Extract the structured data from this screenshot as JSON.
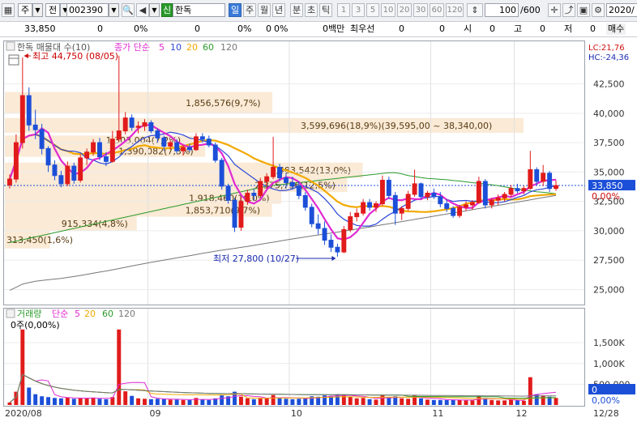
{
  "toolbar": {
    "market": "주",
    "market_type": "전",
    "code": "002390",
    "stock_tag": "신",
    "stock_name": "한독",
    "periods": [
      "일",
      "주",
      "월",
      "년",
      "분",
      "초",
      "틱"
    ],
    "selected_period": "일",
    "minutes": [
      "1",
      "3",
      "5",
      "10",
      "20",
      "30",
      "60",
      "120"
    ],
    "count": "100",
    "count_total": "/600",
    "date": "2020/",
    "right_label": "매수"
  },
  "inforow": {
    "price": "33,850",
    "change": "0",
    "pct1": "0",
    "pct1_unit": "0%",
    "v2": "0",
    "v2_unit": "0%",
    "v3": "0",
    "v3_unit": "0%",
    "v4_label": "0백만",
    "priority_label": "최우선",
    "v5": "0",
    "v6": "0",
    "open_label": "시",
    "open": "0",
    "high_label": "고",
    "high": "0",
    "low_label": "저",
    "low": "0"
  },
  "price_legend": {
    "title": "한독 매물대 수(10)",
    "ma_label": "종가 단순",
    "ma_periods": [
      "5",
      "10",
      "20",
      "60",
      "120"
    ],
    "ma_colors": [
      "#e02ad2",
      "#2b46d8",
      "#f2a900",
      "#2a9a2a",
      "#777777"
    ]
  },
  "volume_legend": {
    "title": "거래량",
    "ma_label": "단순",
    "ma_periods": [
      "5",
      "20",
      "60",
      "120"
    ],
    "ma_colors": [
      "#e02ad2",
      "#f2a900",
      "#2a9a2a",
      "#777777"
    ],
    "value_label": "0주(0,00%)"
  },
  "annotations": {
    "max_label": "최고 44,750 (08/05)",
    "min_label": "최저 27,800 (10/27)",
    "volume_profile_labels": [
      "1,856,576(9,7%)",
      "3,599,696(18,9%)(39,595,00 ~ 38,340,00)",
      "1,303,004(7,2%)",
      "1,390,082(7,3%)",
      "2,483,542(13,0%)",
      "2,375,756(12,5%)",
      "1,918,460(10,0%)",
      "1,853,710(9,7%)",
      "915,334(4,8%)",
      "313,450(1,6%)"
    ]
  },
  "right_axis": {
    "lc_label": "LC:21,76",
    "hc_label": "HC:-24,36",
    "price_ticks": [
      "42,500",
      "40,000",
      "37,500",
      "35,000",
      "32,500",
      "30,000",
      "27,500",
      "25,000"
    ],
    "current_price": "33,850",
    "current_pct": "0,00%",
    "volume_ticks": [
      "1,500K",
      "1,000K",
      "500,000"
    ],
    "current_volume": "0",
    "current_vol_pct": "0,00%"
  },
  "x_axis": {
    "labels": [
      "2020/08",
      "09",
      "10",
      "11",
      "12",
      "12/28"
    ]
  },
  "chart_data": {
    "type": "candlestick",
    "y_range": [
      24000,
      45500
    ],
    "volume_range": [
      0,
      2050000
    ],
    "candles": [
      [
        33900,
        34800,
        33600,
        34400,
        60000
      ],
      [
        34400,
        38200,
        34100,
        37500,
        320000
      ],
      [
        37500,
        44750,
        37000,
        41500,
        1820000
      ],
      [
        41500,
        42200,
        38500,
        39000,
        420000
      ],
      [
        39000,
        40300,
        37800,
        38600,
        260000
      ],
      [
        38600,
        39100,
        36500,
        37000,
        210000
      ],
      [
        37000,
        37200,
        35000,
        35600,
        190000
      ],
      [
        35600,
        36000,
        34300,
        34700,
        170000
      ],
      [
        34700,
        35100,
        33700,
        34000,
        160000
      ],
      [
        34000,
        35900,
        33800,
        35500,
        180000
      ],
      [
        35500,
        35800,
        34000,
        34300,
        150000
      ],
      [
        34300,
        36500,
        34100,
        36200,
        170000
      ],
      [
        36200,
        37000,
        35600,
        36700,
        160000
      ],
      [
        36700,
        37800,
        36400,
        37500,
        180000
      ],
      [
        37500,
        37900,
        36000,
        36300,
        150000
      ],
      [
        36300,
        36700,
        35500,
        35900,
        140000
      ],
      [
        35900,
        38500,
        35800,
        37800,
        190000
      ],
      [
        37800,
        44900,
        37600,
        38500,
        1820000
      ],
      [
        38500,
        40100,
        38200,
        39600,
        330000
      ],
      [
        39600,
        39900,
        38500,
        38800,
        220000
      ],
      [
        38800,
        39300,
        38300,
        38900,
        160000
      ],
      [
        38900,
        39500,
        38500,
        39200,
        150000
      ],
      [
        39200,
        39400,
        38300,
        38500,
        140000
      ],
      [
        38500,
        38700,
        37500,
        37900,
        150000
      ],
      [
        37900,
        38100,
        36800,
        37200,
        140000
      ],
      [
        37200,
        37700,
        36900,
        37500,
        130000
      ],
      [
        37500,
        37800,
        36600,
        36800,
        130000
      ],
      [
        36800,
        37300,
        36400,
        37100,
        120000
      ],
      [
        37100,
        37400,
        36700,
        36900,
        120000
      ],
      [
        36900,
        38300,
        36800,
        38000,
        170000
      ],
      [
        38000,
        38300,
        37500,
        37800,
        130000
      ],
      [
        37800,
        38100,
        37100,
        37300,
        120000
      ],
      [
        37300,
        37500,
        35800,
        36000,
        160000
      ],
      [
        36000,
        36200,
        33500,
        33800,
        230000
      ],
      [
        33800,
        34000,
        32300,
        32600,
        210000
      ],
      [
        32600,
        32800,
        29900,
        30300,
        320000
      ],
      [
        30300,
        32900,
        30000,
        32500,
        200000
      ],
      [
        32500,
        33500,
        32200,
        33200,
        160000
      ],
      [
        33200,
        33600,
        32600,
        33000,
        140000
      ],
      [
        33000,
        34500,
        32900,
        34200,
        170000
      ],
      [
        34200,
        34900,
        33600,
        34600,
        160000
      ],
      [
        34600,
        38000,
        34400,
        35400,
        240000
      ],
      [
        35400,
        35700,
        34200,
        34500,
        170000
      ],
      [
        34500,
        34900,
        33600,
        34100,
        150000
      ],
      [
        34100,
        34600,
        33500,
        33800,
        140000
      ],
      [
        33800,
        34200,
        32700,
        33000,
        150000
      ],
      [
        33000,
        33300,
        31700,
        32000,
        170000
      ],
      [
        32000,
        32300,
        30300,
        30600,
        210000
      ],
      [
        30600,
        31400,
        29700,
        30200,
        200000
      ],
      [
        30200,
        30800,
        28800,
        29200,
        230000
      ],
      [
        29200,
        29700,
        28200,
        28600,
        220000
      ],
      [
        28600,
        28900,
        27800,
        28200,
        260000
      ],
      [
        28200,
        30400,
        28100,
        30100,
        250000
      ],
      [
        30100,
        31600,
        29900,
        31200,
        200000
      ],
      [
        31200,
        31900,
        30800,
        31500,
        160000
      ],
      [
        31500,
        32700,
        31300,
        32400,
        170000
      ],
      [
        32400,
        32700,
        31700,
        32000,
        140000
      ],
      [
        32000,
        32500,
        31600,
        32300,
        130000
      ],
      [
        32300,
        34700,
        32100,
        34300,
        240000
      ],
      [
        34300,
        34600,
        32700,
        33000,
        180000
      ],
      [
        33000,
        33300,
        30500,
        31500,
        210000
      ],
      [
        31500,
        32100,
        30900,
        31900,
        160000
      ],
      [
        31900,
        33400,
        31700,
        33100,
        150000
      ],
      [
        33100,
        35200,
        32900,
        34000,
        230000
      ],
      [
        34000,
        34100,
        32700,
        32900,
        160000
      ],
      [
        32900,
        33400,
        32600,
        33200,
        130000
      ],
      [
        33200,
        33600,
        32700,
        32900,
        120000
      ],
      [
        32900,
        33300,
        32000,
        32300,
        120000
      ],
      [
        32300,
        32700,
        31600,
        31900,
        120000
      ],
      [
        31900,
        32100,
        31100,
        31300,
        130000
      ],
      [
        31300,
        32200,
        31100,
        32000,
        120000
      ],
      [
        32000,
        32500,
        31700,
        32200,
        110000
      ],
      [
        32200,
        32600,
        31800,
        32400,
        110000
      ],
      [
        32400,
        34600,
        32300,
        34200,
        220000
      ],
      [
        34200,
        34400,
        31900,
        32200,
        170000
      ],
      [
        32200,
        32800,
        31900,
        32600,
        120000
      ],
      [
        32600,
        33100,
        32200,
        32800,
        110000
      ],
      [
        32800,
        33300,
        32500,
        33100,
        110000
      ],
      [
        33100,
        33900,
        32900,
        33600,
        130000
      ],
      [
        33600,
        34000,
        33200,
        33400,
        110000
      ],
      [
        33400,
        33800,
        33100,
        33600,
        100000
      ],
      [
        33600,
        36800,
        33500,
        35200,
        670000
      ],
      [
        35200,
        35400,
        33900,
        34200,
        260000
      ],
      [
        34200,
        35600,
        33800,
        34900,
        230000
      ],
      [
        34900,
        35100,
        33300,
        33600,
        200000
      ],
      [
        33600,
        34300,
        33400,
        33850,
        170000
      ]
    ]
  }
}
